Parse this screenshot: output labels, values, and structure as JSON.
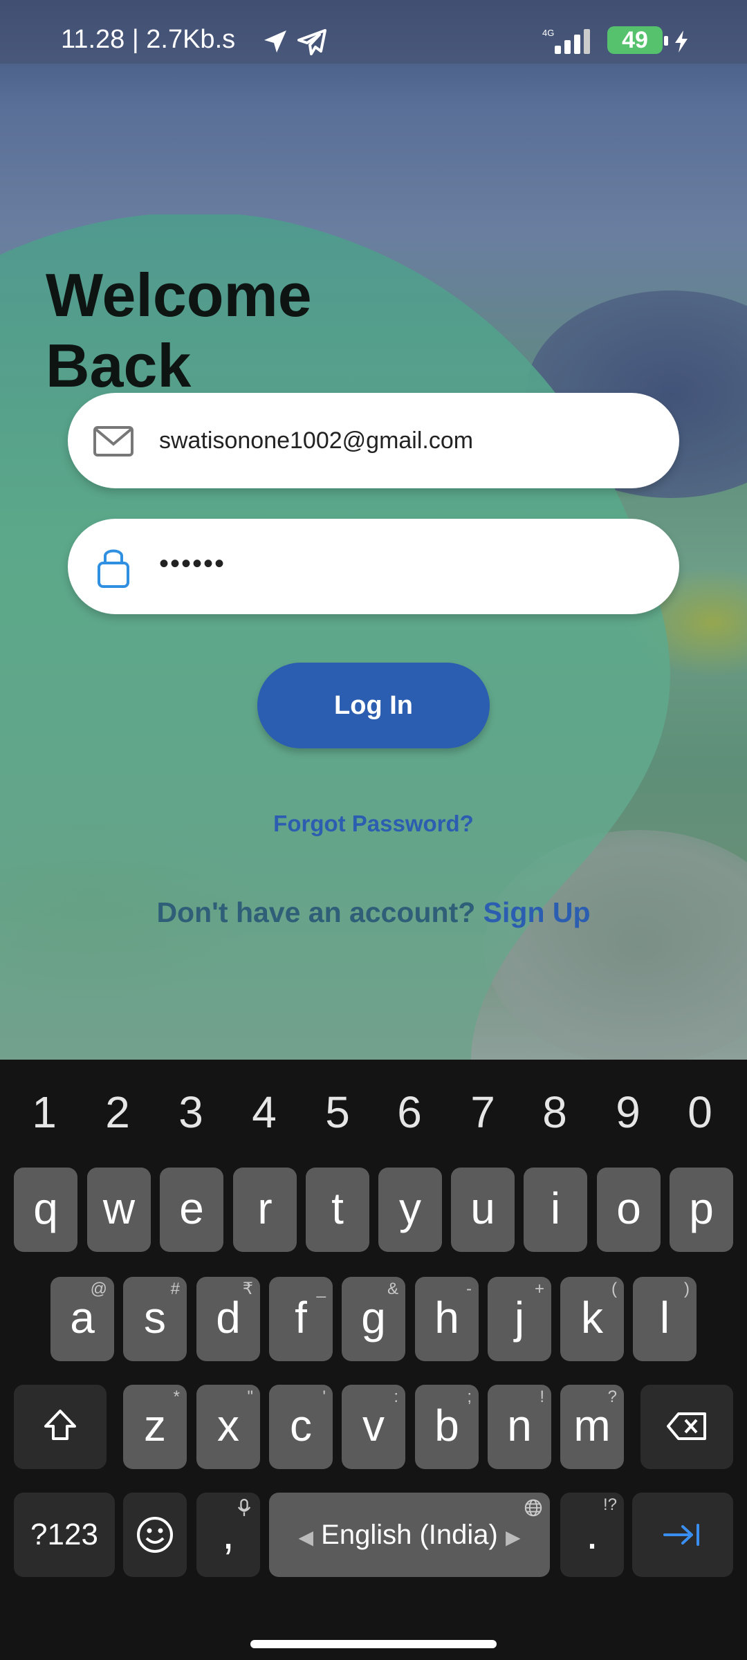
{
  "status_bar": {
    "time_speed": "11.28 | 2.7Kb.s",
    "network": "4G",
    "battery": "49"
  },
  "login": {
    "title_line1": "Welcome",
    "title_line2": "Back",
    "email_value": "swatisonone1002@gmail.com",
    "password_value": "••••••",
    "login_button": "Log In",
    "forgot_password": "Forgot Password?",
    "signup_question": "Don't have an account?",
    "signup_link": "Sign Up"
  },
  "keyboard": {
    "numbers": [
      "1",
      "2",
      "3",
      "4",
      "5",
      "6",
      "7",
      "8",
      "9",
      "0"
    ],
    "row1": [
      "q",
      "w",
      "e",
      "r",
      "t",
      "y",
      "u",
      "i",
      "o",
      "p"
    ],
    "row2": [
      {
        "k": "a",
        "h": "@"
      },
      {
        "k": "s",
        "h": "#"
      },
      {
        "k": "d",
        "h": "₹"
      },
      {
        "k": "f",
        "h": "_"
      },
      {
        "k": "g",
        "h": "&"
      },
      {
        "k": "h",
        "h": "-"
      },
      {
        "k": "j",
        "h": "+"
      },
      {
        "k": "k",
        "h": "("
      },
      {
        "k": "l",
        "h": ")"
      }
    ],
    "row3": [
      {
        "k": "z",
        "h": "*"
      },
      {
        "k": "x",
        "h": "\""
      },
      {
        "k": "c",
        "h": "'"
      },
      {
        "k": "v",
        "h": ":"
      },
      {
        "k": "b",
        "h": ";"
      },
      {
        "k": "n",
        "h": "!"
      },
      {
        "k": "m",
        "h": "?"
      }
    ],
    "symbols_key": "?123",
    "comma_key": ",",
    "space_label": "English (India)",
    "period_key": ".",
    "period_hint": "!?"
  },
  "colors": {
    "accent": "#2b5db0",
    "teal_shape": "#4aa38a",
    "battery": "#57c26d"
  }
}
